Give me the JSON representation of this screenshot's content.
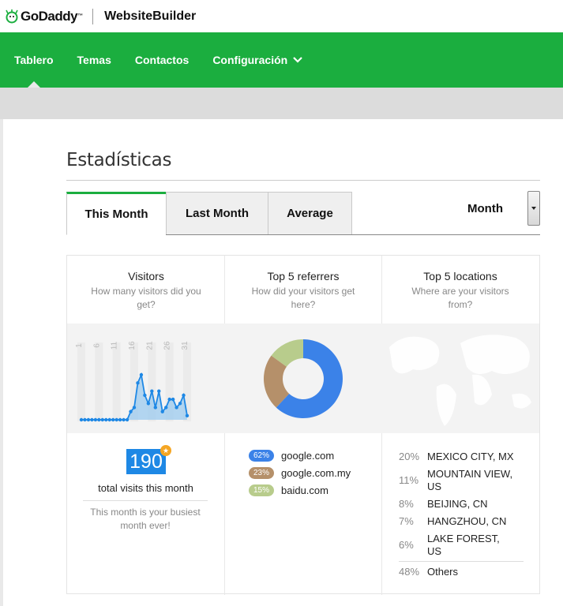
{
  "brand": {
    "logo_text": "GoDaddy",
    "logo_tm": "™",
    "product": "WebsiteBuilder"
  },
  "nav": {
    "items": [
      "Tablero",
      "Temas",
      "Contactos",
      "Configuración"
    ]
  },
  "page_title": "Estadísticas",
  "tabs": [
    "This Month",
    "Last Month",
    "Average"
  ],
  "period_select": {
    "selected": "Month"
  },
  "columns": [
    {
      "title": "Visitors",
      "subtitle": "How many visitors did you get?"
    },
    {
      "title": "Top 5 referrers",
      "subtitle": "How did your visitors get here?"
    },
    {
      "title": "Top 5 locations",
      "subtitle": "Where are your visitors from?"
    }
  ],
  "visitors": {
    "total": "190",
    "total_label": "total visits this month",
    "busiest_note": "This month is your busiest month ever!",
    "x_ticks": [
      "1",
      "6",
      "11",
      "16",
      "21",
      "26",
      "31"
    ],
    "daily": [
      0,
      0,
      0,
      0,
      0,
      0,
      0,
      0,
      0,
      0,
      0,
      0,
      0,
      0,
      2,
      3,
      9,
      11,
      6,
      4,
      7,
      3,
      7,
      2,
      3,
      5,
      5,
      3,
      4,
      6,
      1
    ]
  },
  "referrers": [
    {
      "pct": "62%",
      "name": "google.com",
      "value": 62,
      "color": "#3b82e8"
    },
    {
      "pct": "23%",
      "name": "google.com.my",
      "value": 23,
      "color": "#b5906a"
    },
    {
      "pct": "15%",
      "name": "baidu.com",
      "value": 15,
      "color": "#b8cc8c"
    }
  ],
  "locations": [
    {
      "pct": "20%",
      "name": "MEXICO CITY, MX"
    },
    {
      "pct": "11%",
      "name": "MOUNTAIN VIEW, US"
    },
    {
      "pct": "8%",
      "name": "BEIJING, CN"
    },
    {
      "pct": "7%",
      "name": "HANGZHOU, CN"
    },
    {
      "pct": "6%",
      "name": "LAKE FOREST, US"
    },
    {
      "pct": "48%",
      "name": "Others"
    }
  ],
  "colors": {
    "brand_green": "#1bae3f",
    "accent_blue": "#1e88e5",
    "star_gold": "#f5a623"
  }
}
